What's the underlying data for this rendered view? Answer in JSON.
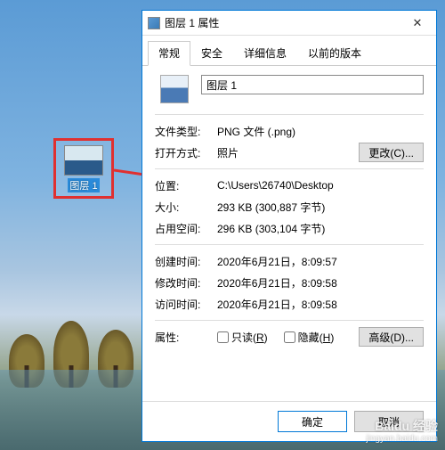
{
  "desktop": {
    "icon_label": "图层 1"
  },
  "dialog": {
    "title": "图层 1 属性",
    "tabs": {
      "general": "常规",
      "security": "安全",
      "details": "详细信息",
      "previous": "以前的版本"
    },
    "filename": "图层 1",
    "rows": {
      "filetype_label": "文件类型:",
      "filetype_value": "PNG 文件 (.png)",
      "openwith_label": "打开方式:",
      "openwith_value": "照片",
      "change_btn": "更改(C)...",
      "location_label": "位置:",
      "location_value": "C:\\Users\\26740\\Desktop",
      "size_label": "大小:",
      "size_value": "293 KB (300,887 字节)",
      "sizedisk_label": "占用空间:",
      "sizedisk_value": "296 KB (303,104 字节)",
      "created_label": "创建时间:",
      "created_value": "2020年6月21日，8:09:57",
      "modified_label": "修改时间:",
      "modified_value": "2020年6月21日，8:09:58",
      "accessed_label": "访问时间:",
      "accessed_value": "2020年6月21日，8:09:58",
      "attributes_label": "属性:",
      "readonly_label": "只读(",
      "readonly_key": "R",
      "readonly_close": ")",
      "hidden_label": "隐藏(",
      "hidden_key": "H",
      "hidden_close": ")",
      "advanced_btn": "高级(D)..."
    },
    "footer": {
      "ok": "确定",
      "cancel": "取消"
    }
  },
  "watermark": {
    "brand": "Baidu 经验",
    "url": "jingyan.baidu.com"
  }
}
